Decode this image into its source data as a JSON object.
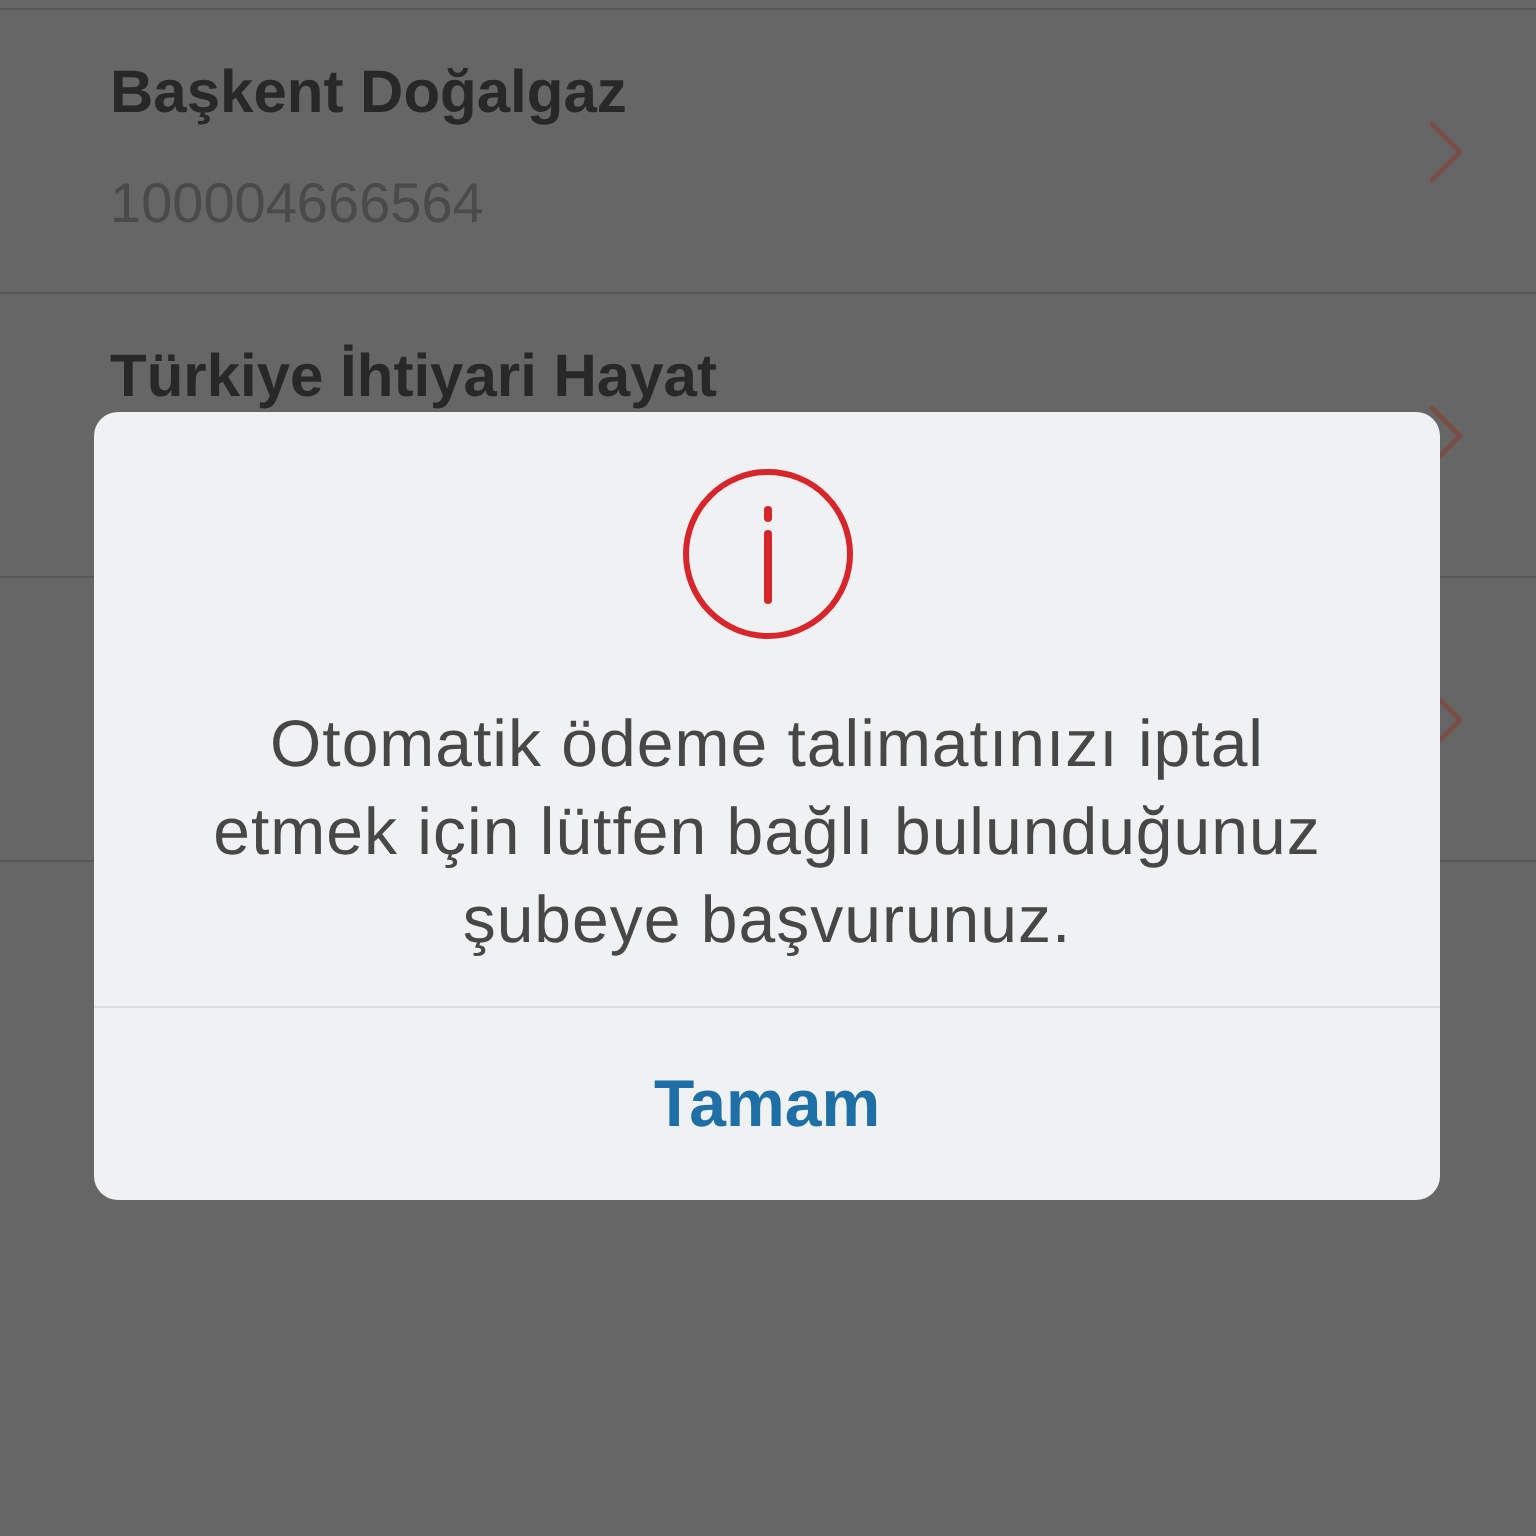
{
  "list": {
    "items": [
      {
        "title": "Başkent Doğalgaz",
        "subtitle": "100004666564",
        "chevron": true
      },
      {
        "title": "Türkiye İhtiyari Hayat",
        "chevron": true
      },
      {
        "chevron": true
      }
    ]
  },
  "dialog": {
    "message": "Otomatik ödeme talimatınızı iptal etmek için lütfen bağlı bulunduğunuz şubeye başvurunuz.",
    "button": "Tamam"
  }
}
